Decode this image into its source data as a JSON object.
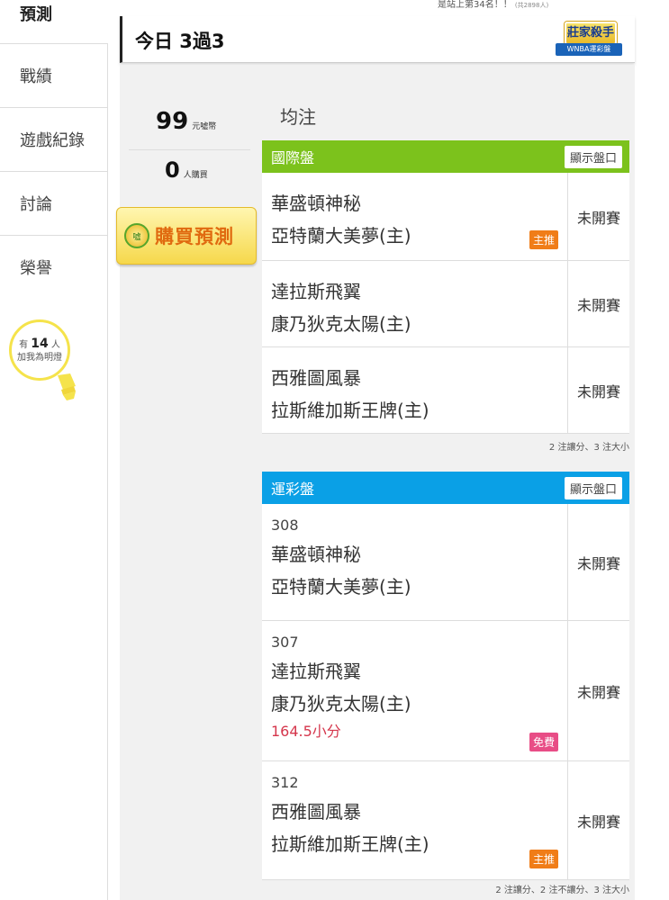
{
  "top_note": {
    "text": "是站上第34名！！",
    "sub": "(共2898人)"
  },
  "sidebar": {
    "active": "預測",
    "items": [
      {
        "label": "戰績"
      },
      {
        "label": "遊戲紀錄"
      },
      {
        "label": "討論"
      },
      {
        "label": "榮譽"
      }
    ],
    "fans": {
      "prefix": "有",
      "count": "14",
      "suffix": "人",
      "line2": "加我為明燈"
    }
  },
  "header": {
    "title": "今日 3過3",
    "logo_line1": "莊家殺手",
    "logo_line2": "WNBA運彩盤"
  },
  "stats": {
    "coins_value": "99",
    "coins_unit": "元噓幣",
    "buyers_value": "0",
    "buyers_unit": "人購買",
    "buy_button": "購買預測",
    "buy_coin_glyph": "噓"
  },
  "bet_type": "均注",
  "international": {
    "title": "國際盤",
    "show_button": "顯示盤口",
    "rows": [
      {
        "away": "華盛頓神秘",
        "home": "亞特蘭大美夢(主)",
        "status": "未開賽",
        "tag": "主推"
      },
      {
        "away": "達拉斯飛翼",
        "home": "康乃狄克太陽(主)",
        "status": "未開賽",
        "tag": ""
      },
      {
        "away": "西雅圖風暴",
        "home": "拉斯維加斯王牌(主)",
        "status": "未開賽",
        "tag": ""
      }
    ],
    "footer": "2 注讓分、3 注大小"
  },
  "sportslottery": {
    "title": "運彩盤",
    "show_button": "顯示盤口",
    "rows": [
      {
        "num": "308",
        "away": "華盛頓神秘",
        "home": "亞特蘭大美夢(主)",
        "status": "未開賽"
      },
      {
        "num": "307",
        "away": "達拉斯飛翼",
        "home": "康乃狄克太陽(主)",
        "status": "未開賽",
        "note": "164.5小分",
        "tag": "免費"
      },
      {
        "num": "312",
        "away": "西雅圖風暴",
        "home": "拉斯維加斯王牌(主)",
        "status": "未開賽",
        "tag": "主推"
      }
    ],
    "footer": "2 注讓分、2 注不讓分、3 注大小"
  },
  "colors": {
    "international": "#7cc21c",
    "sportslottery": "#0aa0e6",
    "tag_main": "#f07d18",
    "tag_free": "#e84d86"
  }
}
